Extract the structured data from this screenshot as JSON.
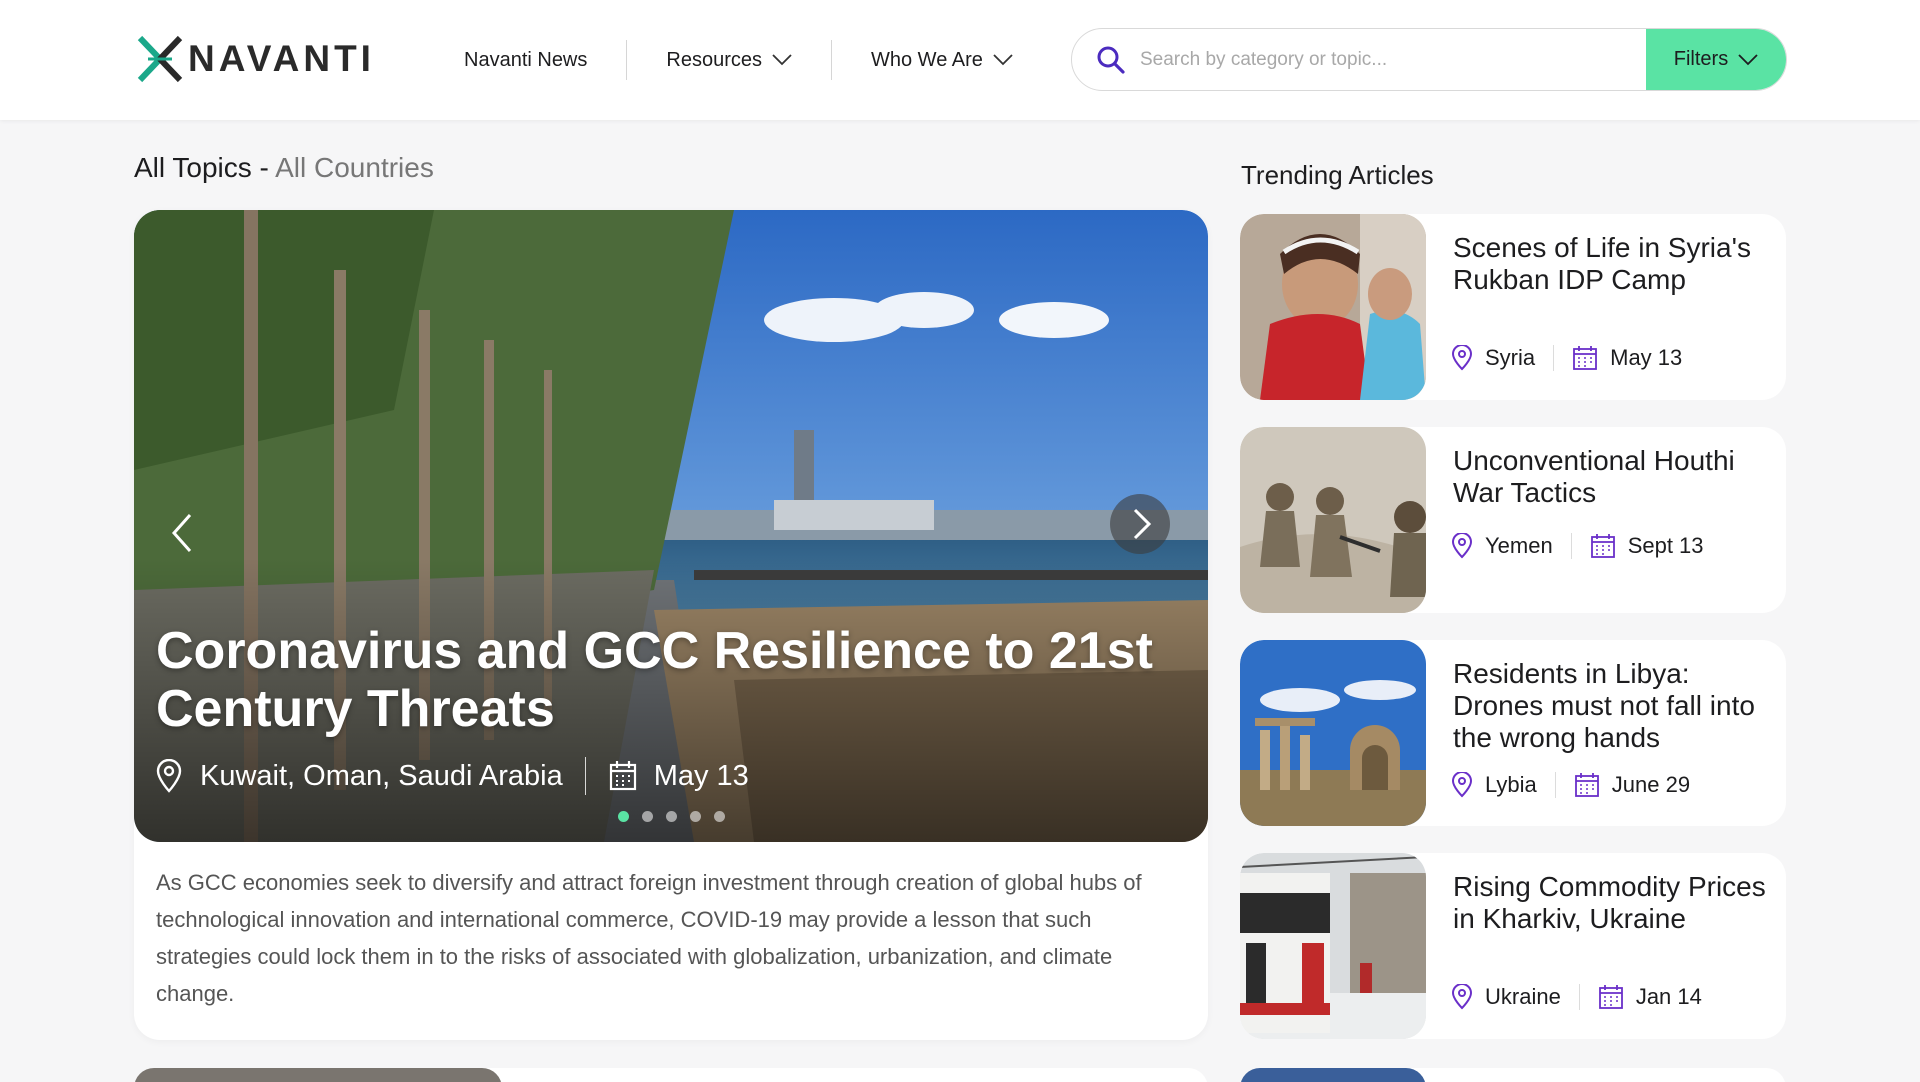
{
  "brand": {
    "name": "NAVANTI",
    "accent": "#5ae3a4",
    "logo_color": "#1ba88a"
  },
  "nav": {
    "items": [
      {
        "label": "Navanti News",
        "has_dropdown": false
      },
      {
        "label": "Resources",
        "has_dropdown": true
      },
      {
        "label": "Who We Are",
        "has_dropdown": true
      }
    ]
  },
  "search": {
    "placeholder": "Search by category or topic...",
    "value": "",
    "filters_label": "Filters"
  },
  "section": {
    "title": "All Topics",
    "separator": " - ",
    "subtitle": "All Countries"
  },
  "hero": {
    "title": "Coronavirus and GCC Resilience to 21st Century Threats",
    "location": "Kuwait, Oman, Saudi Arabia",
    "date": "May 13",
    "slide_count": 5,
    "active_slide": 0,
    "description": "As GCC economies seek to diversify and attract foreign investment through creation of global hubs of technological innovation and international commerce, COVID-19 may provide a lesson that such strategies could lock them in to the risks of associated with globalization, urbanization, and climate change."
  },
  "trending": {
    "title": "Trending Articles",
    "articles": [
      {
        "title": "Scenes of Life in Syria's Rukban IDP Camp",
        "location": "Syria",
        "date": "May 13"
      },
      {
        "title": "Unconventional Houthi War Tactics",
        "location": "Yemen",
        "date": "Sept 13"
      },
      {
        "title": "Residents in Libya: Drones must not fall into the wrong hands",
        "location": "Lybia",
        "date": "June 29"
      },
      {
        "title": "Rising Commodity Prices in Kharkiv, Ukraine",
        "location": "Ukraine",
        "date": "Jan 14"
      }
    ]
  },
  "icons": {
    "search": "search-icon",
    "chevron": "chevron-down-icon",
    "location": "map-pin-icon",
    "calendar": "calendar-icon",
    "prev": "chevron-left-icon",
    "next": "chevron-right-icon"
  }
}
